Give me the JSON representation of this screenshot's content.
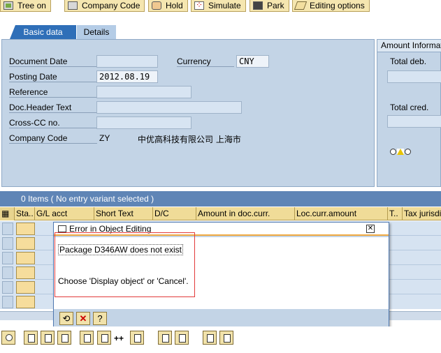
{
  "toolbar": {
    "buttons": [
      {
        "label": "Tree on",
        "icon": "tree-icon"
      },
      {
        "label": "Company Code",
        "icon": "company-code-icon"
      },
      {
        "label": "Hold",
        "icon": "hold-hand-icon"
      },
      {
        "label": "Simulate",
        "icon": "simulate-icon"
      },
      {
        "label": "Park",
        "icon": "park-disk-icon"
      },
      {
        "label": "Editing options",
        "icon": "pencil-icon"
      }
    ]
  },
  "tabs": {
    "basic": "Basic data",
    "details": "Details"
  },
  "header": {
    "document_date": {
      "label": "Document Date",
      "value": ""
    },
    "posting_date": {
      "label": "Posting Date",
      "value": "2012.08.19"
    },
    "reference": {
      "label": "Reference",
      "value": ""
    },
    "doc_header_text": {
      "label": "Doc.Header Text",
      "value": ""
    },
    "cross_cc": {
      "label": "Cross-CC no.",
      "value": ""
    },
    "company_code": {
      "label": "Company Code",
      "code": "ZY",
      "name": "中优高科技有限公司 上海市"
    },
    "currency": {
      "label": "Currency",
      "value": "CNY"
    }
  },
  "amount_panel": {
    "title": "Amount Information",
    "total_deb_label": "Total deb.",
    "total_cred_label": "Total cred."
  },
  "items": {
    "status_text": "0 Items ( No entry variant selected )",
    "columns": [
      "Sta..",
      "G/L acct",
      "Short Text",
      "D/C",
      "Amount in doc.curr.",
      "Loc.curr.amount",
      "T..",
      "Tax jurisdi"
    ]
  },
  "dialog": {
    "title": "Error in Object Editing",
    "message1": "Package D346AW does not exist",
    "message2": "Choose 'Display object' or 'Cancel'."
  },
  "bottom_toolbar": {
    "plusplus": "++"
  }
}
